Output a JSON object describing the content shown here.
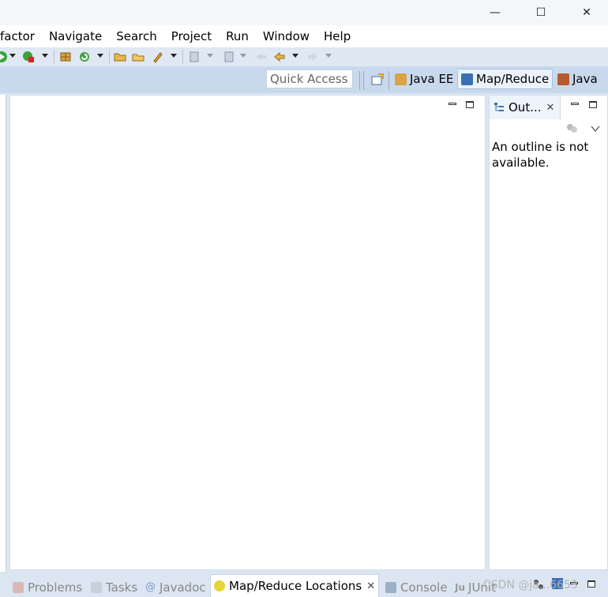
{
  "window": {
    "minimize_symbol": "—",
    "maximize_symbol": "☐",
    "close_symbol": "✕"
  },
  "menu": {
    "items": [
      "factor",
      "Navigate",
      "Search",
      "Project",
      "Run",
      "Window",
      "Help"
    ]
  },
  "toolbar": {
    "icons": [
      "run-icon",
      "debug-icon",
      "new-package-icon",
      "refresh-icon",
      "open-folder-icon",
      "open-file-icon",
      "edit-icon",
      "annotation-nav-icon",
      "next-annotation-icon",
      "back-arrow-icon",
      "forward-arrow-icon"
    ]
  },
  "perspectives": {
    "quick_access_placeholder": "Quick Access",
    "items": [
      {
        "label": "Java EE",
        "active": false,
        "icon": "java-ee-icon"
      },
      {
        "label": "Map/Reduce",
        "active": true,
        "icon": "elephant-icon"
      },
      {
        "label": "Java",
        "active": false,
        "icon": "java-icon"
      }
    ]
  },
  "outline": {
    "tab_label": "Out...",
    "close_symbol": "✕",
    "message": "An outline is not available."
  },
  "bottom_tabs": [
    {
      "label": "Problems",
      "active": false,
      "icon": "problems-icon"
    },
    {
      "label": "Tasks",
      "active": false,
      "icon": "tasks-icon"
    },
    {
      "label": "Javadoc",
      "active": false,
      "icon": "at-icon"
    },
    {
      "label": "Map/Reduce Locations",
      "active": true,
      "icon": "elephant-location-icon"
    },
    {
      "label": "Console",
      "active": false,
      "icon": "console-icon"
    },
    {
      "label": "JUnit",
      "active": false,
      "icon": "junit-icon"
    }
  ],
  "watermark": "CSDN @ja...6653",
  "colors": {
    "accent": "#3b6fb5",
    "active_tab_bg": "#eaf2fc"
  }
}
